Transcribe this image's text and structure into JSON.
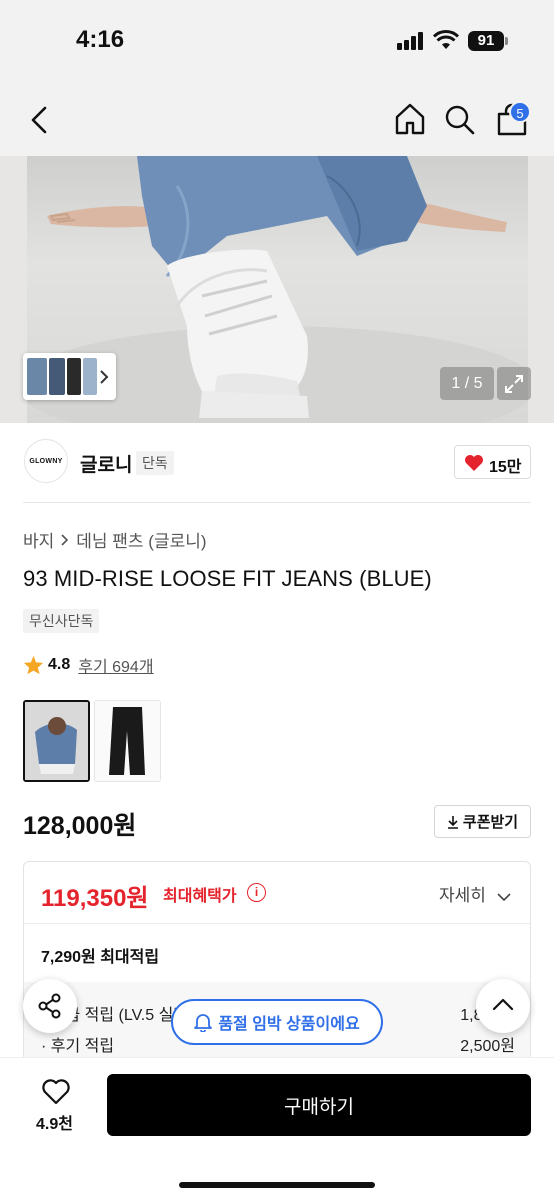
{
  "status": {
    "time": "4:16",
    "battery": "91"
  },
  "nav": {
    "cart_count": "5"
  },
  "gallery": {
    "counter": "1 / 5"
  },
  "brand": {
    "logo_text": "GLOWNY",
    "name": "글로니",
    "tag": "단독",
    "likes": "15만"
  },
  "breadcrumb": {
    "items": [
      "바지",
      "데님 팬츠 (글로니)"
    ]
  },
  "product": {
    "title": "93 MID-RISE LOOSE FIT JEANS (BLUE)",
    "badge": "무신사단독",
    "rating": "4.8",
    "reviews_label": "후기 694개",
    "price": "128,000원",
    "coupon_label": "쿠폰받기"
  },
  "benefit": {
    "max_price": "119,350원",
    "max_label": "최대혜택가",
    "info": "i",
    "detail_label": "자세히",
    "max_points": "7,290원 최대적립",
    "rows": [
      {
        "label": "· 등급 적립 (LV.5 실버 · 2.5%)",
        "value": "1,800원"
      },
      {
        "label": "· 후기 적립",
        "value": "2,500원"
      }
    ]
  },
  "toast": {
    "text": "품절 임박 상품이에요"
  },
  "bottom": {
    "wish_count": "4.9천",
    "buy_label": "구매하기"
  },
  "colors": {
    "accent_red": "#e5232c",
    "accent_blue": "#2f6fe8"
  }
}
